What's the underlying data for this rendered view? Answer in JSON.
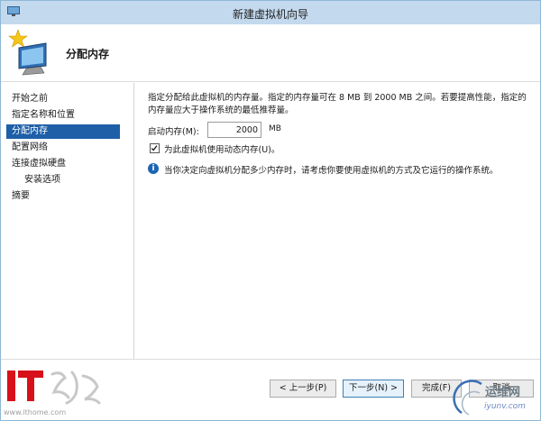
{
  "window": {
    "title": "新建虚拟机向导"
  },
  "header": {
    "page_title": "分配内存"
  },
  "nav": {
    "items": [
      {
        "label": "开始之前"
      },
      {
        "label": "指定名称和位置"
      },
      {
        "label": "分配内存"
      },
      {
        "label": "配置网络"
      },
      {
        "label": "连接虚拟硬盘"
      },
      {
        "label": "安装选项"
      },
      {
        "label": "摘要"
      }
    ],
    "selected_index": 2
  },
  "content": {
    "description": "指定分配给此虚拟机的内存量。指定的内存量可在 8 MB 到 2000 MB 之间。若要提高性能，指定的内存量应大于操作系统的最低推荐量。",
    "memory_label": "启动内存(M):",
    "memory_value": "2000",
    "memory_unit": "MB",
    "dynamic_memory_label": "为此虚拟机使用动态内存(U)。",
    "dynamic_memory_checked": true,
    "info_text": "当你决定向虚拟机分配多少内存时，请考虑你要使用虚拟机的方式及它运行的操作系统。"
  },
  "footer": {
    "prev_label": "< 上一步(P)",
    "next_label": "下一步(N) >",
    "finish_label": "完成(F)",
    "cancel_label": "取消"
  },
  "watermarks": {
    "it_url": "www.ithome.com",
    "yw_title": "运维网",
    "yw_url": "iyunv.com"
  },
  "colors": {
    "titlebar": "#c3d9ee",
    "selection": "#1e5fa8",
    "info": "#1e64b4"
  }
}
